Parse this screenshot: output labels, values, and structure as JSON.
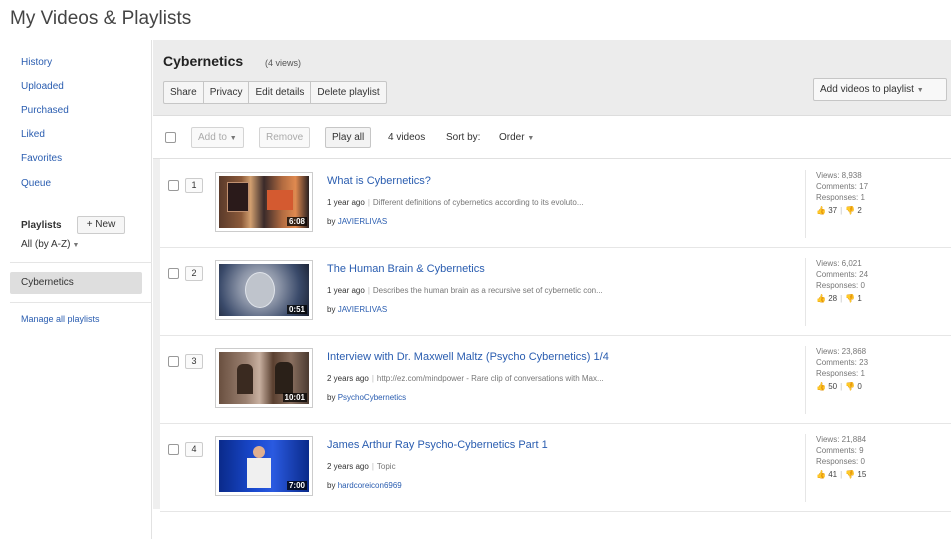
{
  "page": {
    "title": "My Videos & Playlists"
  },
  "sidebar": {
    "links": [
      {
        "label": "History"
      },
      {
        "label": "Uploaded"
      },
      {
        "label": "Purchased"
      },
      {
        "label": "Liked"
      },
      {
        "label": "Favorites"
      },
      {
        "label": "Queue"
      }
    ],
    "playlists_label": "Playlists",
    "new_label": "+ New",
    "sort_label": "All (by A-Z)",
    "selected_playlist": "Cybernetics",
    "manage_label": "Manage all playlists"
  },
  "playlist": {
    "title": "Cybernetics",
    "views": "(4 views)",
    "buttons": [
      "Share",
      "Privacy",
      "Edit details",
      "Delete playlist"
    ],
    "add_videos_label": "Add videos to playlist"
  },
  "toolbar": {
    "add_to_label": "Add to",
    "remove_label": "Remove",
    "play_all_label": "Play all",
    "video_count": "4 videos",
    "sort_by_label": "Sort by:",
    "sort_value": "Order"
  },
  "videos": [
    {
      "index": "1",
      "duration": "6:08",
      "title": "What is Cybernetics?",
      "age": "1 year ago",
      "description": "Different definitions of cybernetics according to its evoluto...",
      "by": "by",
      "channel": "JAVIERLIVAS",
      "views": "Views: 8,938",
      "comments": "Comments: 17",
      "responses": "Responses: 1",
      "likes": "37",
      "dislikes": "2"
    },
    {
      "index": "2",
      "duration": "0:51",
      "title": "The Human Brain & Cybernetics",
      "age": "1 year ago",
      "description": "Describes the human brain as a recursive set of cybernetic con...",
      "by": "by",
      "channel": "JAVIERLIVAS",
      "views": "Views: 6,021",
      "comments": "Comments: 24",
      "responses": "Responses: 0",
      "likes": "28",
      "dislikes": "1"
    },
    {
      "index": "3",
      "duration": "10:01",
      "title": "Interview with Dr. Maxwell Maltz (Psycho Cybernetics) 1/4",
      "age": "2 years ago",
      "description": "http://ez.com/mindpower - Rare clip of conversations with Max...",
      "by": "by",
      "channel": "PsychoCybernetics",
      "views": "Views: 23,868",
      "comments": "Comments: 23",
      "responses": "Responses: 1",
      "likes": "50",
      "dislikes": "0"
    },
    {
      "index": "4",
      "duration": "7:00",
      "title": "James Arthur Ray Psycho-Cybernetics Part 1",
      "age": "2 years ago",
      "description": "Topic",
      "by": "by",
      "channel": "hardcoreicon6969",
      "views": "Views: 21,884",
      "comments": "Comments: 9",
      "responses": "Responses: 0",
      "likes": "41",
      "dislikes": "15"
    }
  ],
  "colors": {
    "link": "#2a5db0",
    "header_band": "#ececec",
    "selected": "#dedede"
  },
  "icons": [
    "thumbs-up-icon",
    "thumbs-down-icon",
    "chevron-down-icon",
    "checkbox-icon"
  ]
}
